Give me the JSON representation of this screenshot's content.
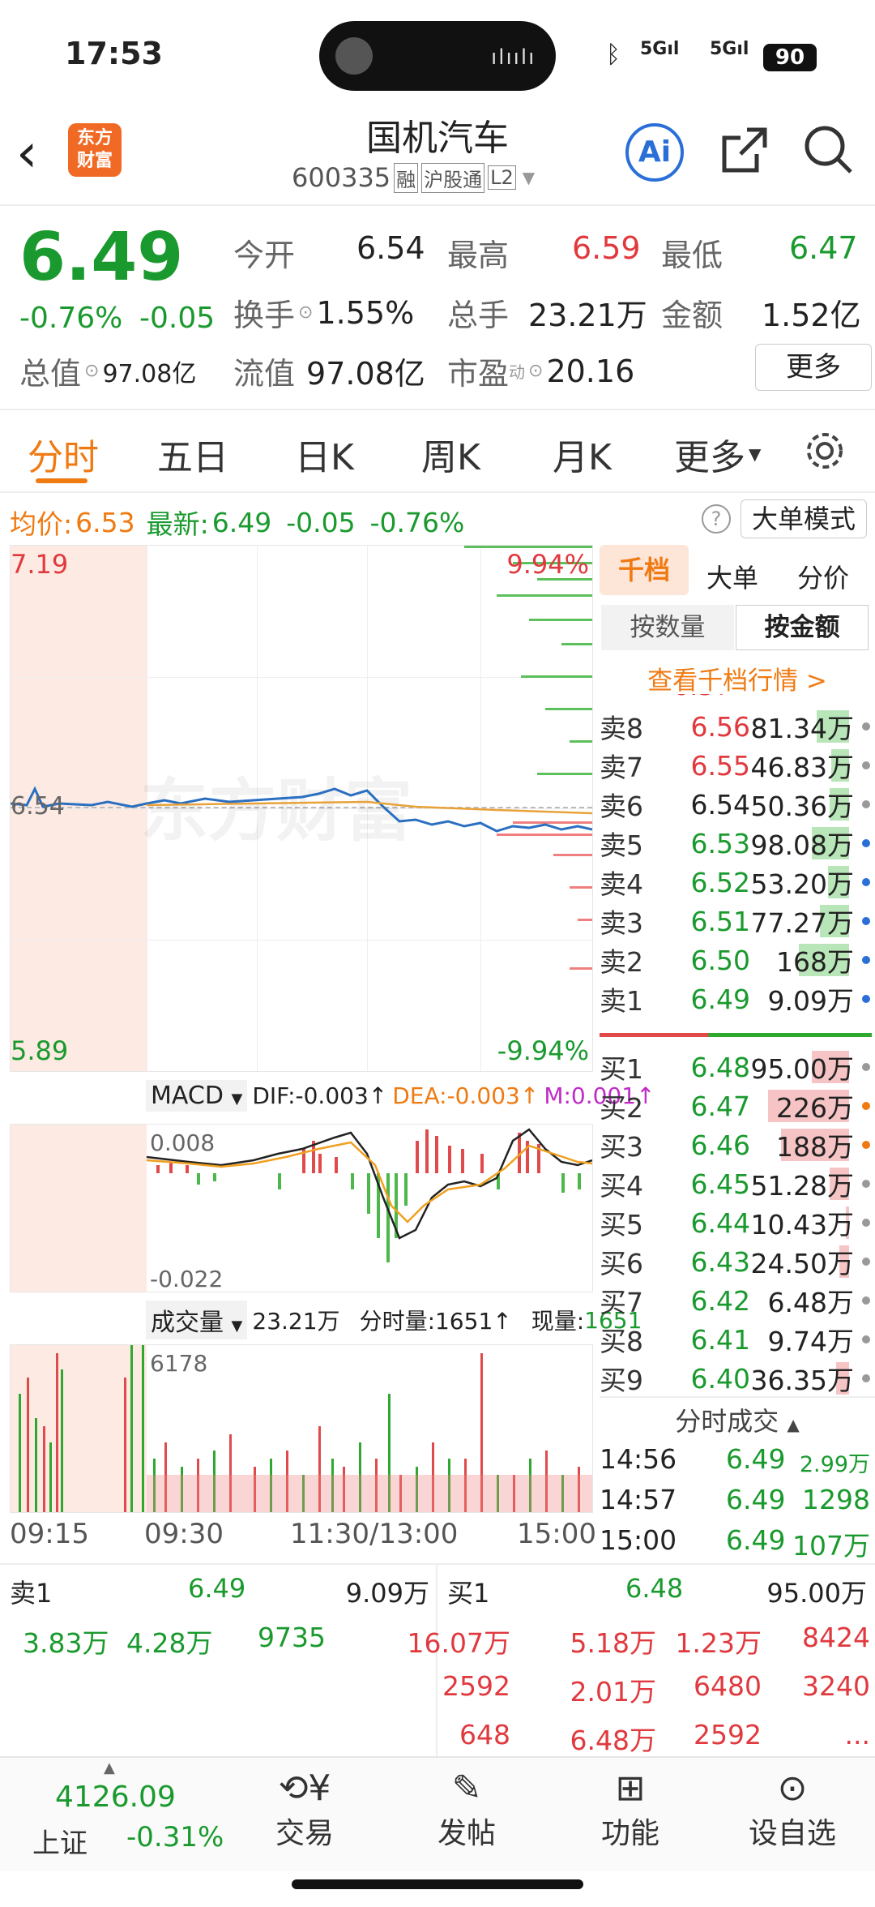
{
  "status": {
    "time": "17:53",
    "signal1": "5G",
    "signal2": "5G",
    "battery": "90"
  },
  "header": {
    "title": "国机汽车",
    "code": "600335",
    "tags": [
      "融",
      "沪股通",
      "L2"
    ],
    "logo": "东方\n财富",
    "ai": "Ai"
  },
  "quote": {
    "price": "6.49",
    "pct": "-0.76%",
    "chg": "-0.05",
    "open_l": "今开",
    "open": "6.54",
    "high_l": "最高",
    "high": "6.59",
    "low_l": "最低",
    "low": "6.47",
    "turn_l": "换手",
    "turn": "1.55%",
    "vol_l": "总手",
    "vol": "23.21万",
    "amt_l": "金额",
    "amt": "1.52亿",
    "cap_l": "总值",
    "cap": "97.08亿",
    "flt_l": "流值",
    "flt": "97.08亿",
    "pe_l": "市盈",
    "pe_sup": "动",
    "pe": "20.16",
    "more": "更多"
  },
  "tabs": [
    "分时",
    "五日",
    "日K",
    "周K",
    "月K",
    "更多"
  ],
  "infobar": {
    "avg_l": "均价:",
    "avg": "6.53",
    "latest_l": "最新:",
    "latest": "6.49",
    "chg": "-0.05",
    "pct": "-0.76%",
    "mode": "大单模式"
  },
  "chart": {
    "ymax": "7.19",
    "ymid": "6.54",
    "ymin": "5.89",
    "pmax": "9.94%",
    "pmin": "-9.94%",
    "watermark": "东方财富",
    "macd_sel": "MACD",
    "dif": "DIF:-0.003↑",
    "dea": "DEA:-0.003↑",
    "m": "M:0.001↑",
    "macd_top": "0.008",
    "macd_bot": "-0.022",
    "vol_sel": "成交量",
    "vol_total": "23.21万",
    "vol_min": "分时量:1651↑",
    "vol_now_l": "现量:",
    "vol_now": "1651",
    "vol_max": "6178",
    "times": [
      "09:15",
      "09:30",
      "11:30/13:00",
      "15:00"
    ]
  },
  "ob_tabs": {
    "t1": "千档",
    "t2": "大单",
    "t3": "分价",
    "s1": "按数量",
    "s2": "按金额",
    "link": "查看千档行情 >"
  },
  "asks": [
    {
      "l": "卖8",
      "p": "6.56",
      "v": "81.34万",
      "bw": 40,
      "dot": "#999"
    },
    {
      "l": "卖7",
      "p": "6.55",
      "v": "46.83万",
      "bw": 22,
      "dot": "#999"
    },
    {
      "l": "卖6",
      "p": "6.54",
      "v": "50.36万",
      "bw": 24,
      "dot": "#999"
    },
    {
      "l": "卖5",
      "p": "6.53",
      "v": "98.08万",
      "bw": 46,
      "dot": "#2a6fd8"
    },
    {
      "l": "卖4",
      "p": "6.52",
      "v": "53.20万",
      "bw": 26,
      "dot": "#2a6fd8"
    },
    {
      "l": "卖3",
      "p": "6.51",
      "v": "77.27万",
      "bw": 36,
      "dot": "#2a6fd8"
    },
    {
      "l": "卖2",
      "p": "6.50",
      "v": "168万",
      "bw": 62,
      "dot": "#2a6fd8"
    },
    {
      "l": "卖1",
      "p": "6.49",
      "v": "9.09万",
      "bw": 0,
      "dot": "#2a6fd8"
    }
  ],
  "bids": [
    {
      "l": "买1",
      "p": "6.48",
      "v": "95.00万",
      "bw": 46,
      "dot": "#999"
    },
    {
      "l": "买2",
      "p": "6.47",
      "v": "226万",
      "bw": 100,
      "dot": "#f07a12"
    },
    {
      "l": "买3",
      "p": "6.46",
      "v": "188万",
      "bw": 84,
      "dot": "#f07a12"
    },
    {
      "l": "买4",
      "p": "6.45",
      "v": "51.28万",
      "bw": 24,
      "dot": "#999"
    },
    {
      "l": "买5",
      "p": "6.44",
      "v": "10.43万",
      "bw": 4,
      "dot": "#999"
    },
    {
      "l": "买6",
      "p": "6.43",
      "v": "24.50万",
      "bw": 12,
      "dot": "#999"
    },
    {
      "l": "买7",
      "p": "6.42",
      "v": "6.48万",
      "bw": 0,
      "dot": "#999"
    },
    {
      "l": "买8",
      "p": "6.41",
      "v": "9.74万",
      "bw": 0,
      "dot": "#999"
    },
    {
      "l": "买9",
      "p": "6.40",
      "v": "36.35万",
      "bw": 16,
      "dot": "#999"
    }
  ],
  "ticks": {
    "title": "分时成交",
    "rows": [
      {
        "t": "14:56",
        "p": "6.49",
        "v": "2.99万"
      },
      {
        "t": "14:57",
        "p": "6.49",
        "v": "1298"
      },
      {
        "t": "15:00",
        "p": "6.49",
        "v": "107万"
      }
    ]
  },
  "queue": {
    "sell_l": "卖1",
    "sell_p": "6.49",
    "sell_v": "9.09万",
    "sell": [
      "3.83万",
      "4.28万",
      "9735"
    ],
    "buy_l": "买1",
    "buy_p": "6.48",
    "buy_v": "95.00万",
    "buy": [
      [
        "16.07万",
        "5.18万",
        "1.23万",
        "8424"
      ],
      [
        "2592",
        "2.01万",
        "6480",
        "3240"
      ],
      [
        "648",
        "6.48万",
        "2592",
        "..."
      ]
    ]
  },
  "nav": {
    "index": "4126.09",
    "index_name": "上证",
    "index_pct": "-0.31%",
    "items": [
      "交易",
      "发帖",
      "功能",
      "设自选"
    ]
  }
}
